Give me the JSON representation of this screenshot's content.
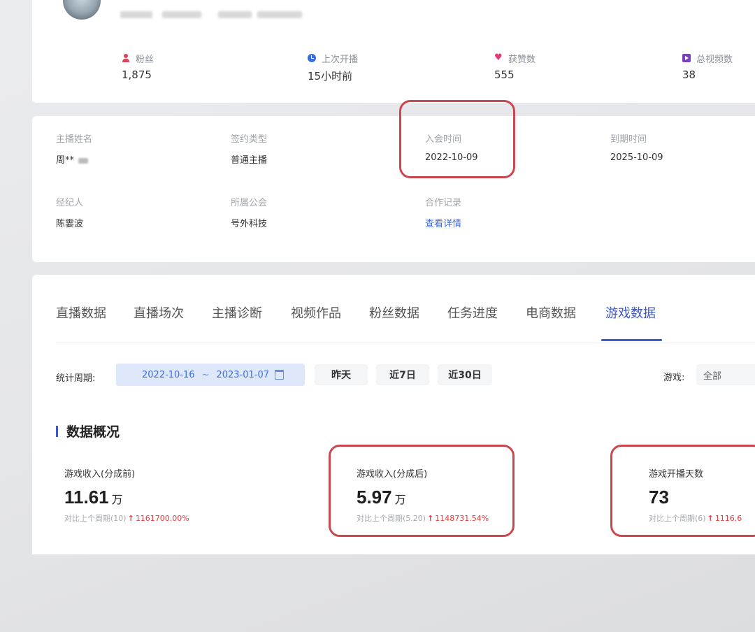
{
  "profile": {
    "stats": [
      {
        "label": "粉丝",
        "value": "1,875",
        "icon": "fans-icon",
        "color": "#e0405a"
      },
      {
        "label": "上次开播",
        "value": "15小时前",
        "icon": "clock-icon",
        "color": "#3b6de0"
      },
      {
        "label": "获赞数",
        "value": "555",
        "icon": "heart-icon",
        "color": "#e03a7a"
      },
      {
        "label": "总视频数",
        "value": "38",
        "icon": "video-icon",
        "color": "#7a3fc0"
      }
    ]
  },
  "info": {
    "items": [
      {
        "label": "主播姓名",
        "value": "周**"
      },
      {
        "label": "签约类型",
        "value": "普通主播"
      },
      {
        "label": "入会时间",
        "value": "2022-10-09"
      },
      {
        "label": "到期时间",
        "value": "2025-10-09"
      },
      {
        "label": "经纪人",
        "value": "陈霎波"
      },
      {
        "label": "所属公会",
        "value": "号外科技"
      },
      {
        "label": "合作记录",
        "value": "查看详情"
      }
    ]
  },
  "tabs": [
    {
      "label": "直播数据"
    },
    {
      "label": "直播场次"
    },
    {
      "label": "主播诊断"
    },
    {
      "label": "视频作品"
    },
    {
      "label": "粉丝数据"
    },
    {
      "label": "任务进度"
    },
    {
      "label": "电商数据"
    },
    {
      "label": "游戏数据",
      "active": true
    }
  ],
  "filter": {
    "period_label": "统计周期:",
    "start_date": "2022-10-16",
    "separator": "~",
    "end_date": "2023-01-07",
    "quick_buttons": [
      "昨天",
      "近7日",
      "近30日"
    ],
    "game_label": "游戏:",
    "game_value": "全部"
  },
  "overview": {
    "title": "数据概况",
    "metrics": [
      {
        "title": "游戏收入(分成前)",
        "value": "11.61",
        "unit": "万",
        "compare_text": "对比上个周期(10)",
        "change": "1161700.00%"
      },
      {
        "title": "游戏收入(分成后)",
        "value": "5.97",
        "unit": "万",
        "compare_text": "对比上个周期(5.20)",
        "change": "1148731.54%"
      },
      {
        "title": "游戏开播天数",
        "value": "73",
        "unit": "",
        "compare_text": "对比上个周期(6)",
        "change": "1116.6"
      }
    ]
  },
  "colors": {
    "accent": "#3f57c7",
    "highlight": "#c9474f",
    "up": "#e03c3c"
  }
}
